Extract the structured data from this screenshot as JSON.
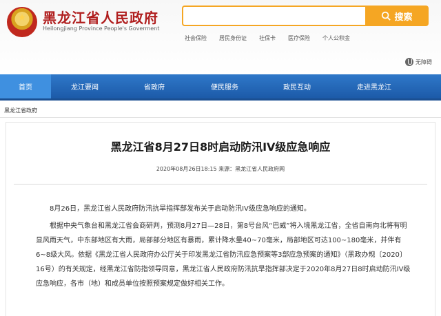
{
  "header": {
    "site_title": "黑龙江省人民政府",
    "site_subtitle": "Heilongjiang Province People's Goverment",
    "search_placeholder": "",
    "search_button": "搜索",
    "quick_links": [
      "社会保险",
      "居民身份证",
      "社保卡",
      "医疗保险",
      "个人公积金"
    ],
    "accessibility": "无障碍"
  },
  "nav": {
    "items": [
      "首页",
      "龙江要闻",
      "省政府",
      "便民服务",
      "政民互动",
      "走进黑龙江"
    ],
    "active_index": 0
  },
  "breadcrumb": "黑龙江省政府",
  "article": {
    "title": "黑龙江省8月27日8时启动防汛IV级应急响应",
    "meta": "2020年08月26日18:15  来源：黑龙江省人民政府网",
    "paragraphs": [
      "8月26日，黑龙江省人民政府防汛抗旱指挥部发布关于启动防汛IV级应急响应的通知。",
      "根据中央气象台和黑龙江省会商研判，预测8月27日—28日，第8号台风“巴威”将入境黑龙江省，全省自南向北将有明显风雨天气，中东部地区有大雨，局部部分地区有暴雨，累计降水量40~70毫米，局部地区可达100~180毫米，并伴有6~8级大风。依据《黑龙江省人民政府办公厅关于印发黑龙江省防汛应急预案等3部应急预案的通知》（黑政办规〔2020〕16号）的有关规定，经黑龙江省防指领导同意，黑龙江省人民政府防汛抗旱指挥部决定于2020年8月27日8时启动防汛IV级应急响应，各市（地）和成员单位按照预案规定做好相关工作。"
    ]
  },
  "colors": {
    "brand_red": "#b01e1e",
    "nav_blue": "#1c5aa8",
    "nav_active": "#3f90e0",
    "search_orange": "#f5a623"
  }
}
